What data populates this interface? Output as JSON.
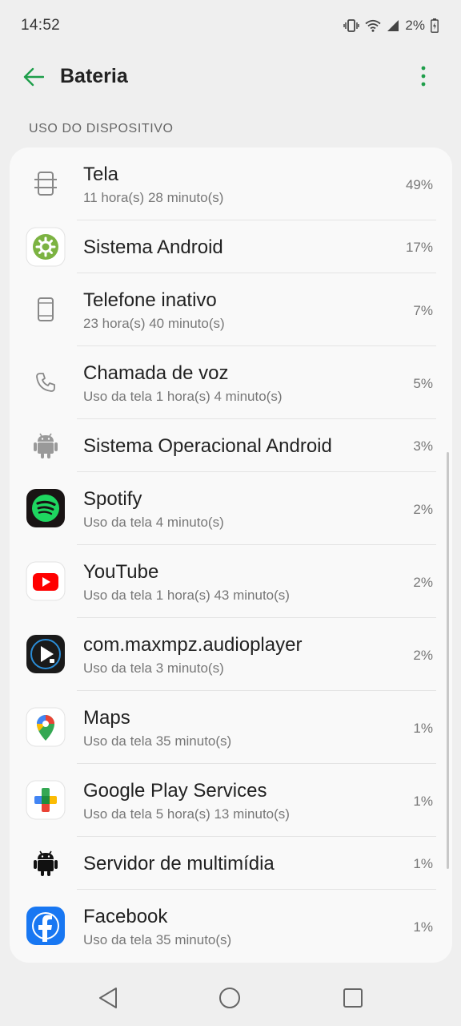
{
  "status_bar": {
    "time": "14:52",
    "battery_percent": "2%"
  },
  "app_bar": {
    "title": "Bateria",
    "accent_color": "#1e9e4a"
  },
  "section": {
    "header": "USO DO DISPOSITIVO"
  },
  "items": [
    {
      "icon": "screen-icon",
      "title": "Tela",
      "subtitle": "11 hora(s) 28 minuto(s)",
      "percent": "49%"
    },
    {
      "icon": "android-system-icon",
      "title": "Sistema Android",
      "subtitle": "",
      "percent": "17%"
    },
    {
      "icon": "phone-idle-icon",
      "title": "Telefone inativo",
      "subtitle": "23 hora(s) 40 minuto(s)",
      "percent": "7%"
    },
    {
      "icon": "voice-call-icon",
      "title": "Chamada de voz",
      "subtitle": "Uso da tela 1 hora(s) 4 minuto(s)",
      "percent": "5%"
    },
    {
      "icon": "android-os-icon",
      "title": "Sistema Operacional Android",
      "subtitle": "",
      "percent": "3%"
    },
    {
      "icon": "spotify-icon",
      "title": "Spotify",
      "subtitle": "Uso da tela 4 minuto(s)",
      "percent": "2%"
    },
    {
      "icon": "youtube-icon",
      "title": "YouTube",
      "subtitle": "Uso da tela 1 hora(s) 43 minuto(s)",
      "percent": "2%"
    },
    {
      "icon": "audioplayer-icon",
      "title": "com.maxmpz.audioplayer",
      "subtitle": "Uso da tela 3 minuto(s)",
      "percent": "2%"
    },
    {
      "icon": "maps-icon",
      "title": "Maps",
      "subtitle": "Uso da tela 35 minuto(s)",
      "percent": "1%"
    },
    {
      "icon": "play-services-icon",
      "title": "Google Play Services",
      "subtitle": "Uso da tela 5 hora(s) 13 minuto(s)",
      "percent": "1%"
    },
    {
      "icon": "media-server-icon",
      "title": "Servidor de multimídia",
      "subtitle": "",
      "percent": "1%"
    },
    {
      "icon": "facebook-icon",
      "title": "Facebook",
      "subtitle": "Uso da tela 35 minuto(s)",
      "percent": "1%"
    }
  ]
}
